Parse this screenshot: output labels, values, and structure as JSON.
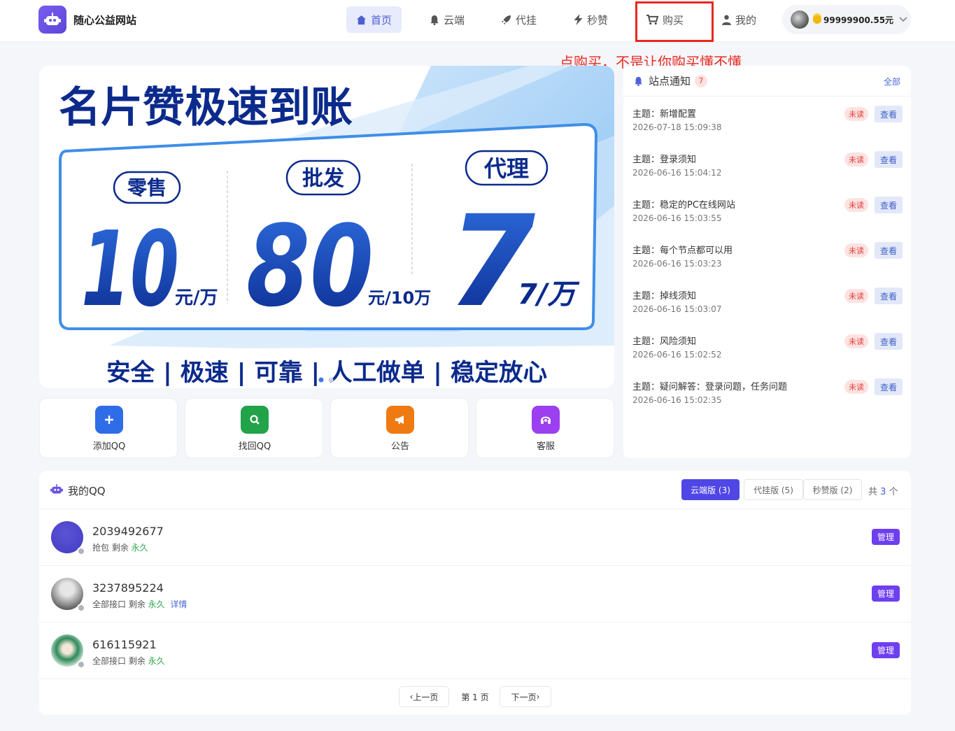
{
  "header": {
    "site_title": "随心公益网站",
    "nav": [
      {
        "label": "首页",
        "icon": "home-icon",
        "active": true
      },
      {
        "label": "云端",
        "icon": "bell-icon"
      },
      {
        "label": "代挂",
        "icon": "rocket-icon"
      },
      {
        "label": "秒赞",
        "icon": "bolt-icon"
      },
      {
        "label": "购买",
        "icon": "cart-icon"
      },
      {
        "label": "我的",
        "icon": "user-icon"
      }
    ],
    "balance": "99999900.55元"
  },
  "annotation": "点购买，不是让你购买懂不懂",
  "banner": {
    "headline": "名片赞极速到账",
    "tiers": [
      {
        "label": "零售",
        "value": "10",
        "unit": "元/万"
      },
      {
        "label": "批发",
        "value": "80",
        "unit": "元/10万"
      },
      {
        "label": "代理",
        "value": "7",
        "unit": "7/万"
      }
    ],
    "tagline": "安全 | 极速 | 可靠 | 人工做单 | 稳定放心"
  },
  "notices": {
    "title": "站点通知",
    "count": "7",
    "all_label": "全部",
    "unread_label": "未读",
    "view_label": "查看",
    "items": [
      {
        "subject": "主题：新增配置",
        "time": "2026-07-18 15:09:38"
      },
      {
        "subject": "主题：登录须知",
        "time": "2026-06-16 15:04:12"
      },
      {
        "subject": "主题：稳定的PC在线网站",
        "time": "2026-06-16 15:03:55"
      },
      {
        "subject": "主题：每个节点都可以用",
        "time": "2026-06-16 15:03:23"
      },
      {
        "subject": "主题：掉线须知",
        "time": "2026-06-16 15:03:07"
      },
      {
        "subject": "主题：风险须知",
        "time": "2026-06-16 15:02:52"
      },
      {
        "subject": "主题：疑问解答：登录问题，任务问题",
        "time": "2026-06-16 15:02:35"
      }
    ]
  },
  "quick_actions": [
    {
      "label": "添加QQ",
      "icon": "plus-icon",
      "color": "#2f6de8"
    },
    {
      "label": "找回QQ",
      "icon": "search-icon",
      "color": "#22a34a"
    },
    {
      "label": "公告",
      "icon": "megaphone-icon",
      "color": "#f07a12"
    },
    {
      "label": "客服",
      "icon": "headset-icon",
      "color": "#9b3ff0"
    }
  ],
  "my_qq": {
    "title": "我的QQ",
    "tabs": [
      {
        "label": "云端版 (3)",
        "active": true
      },
      {
        "label": "代挂版 (5)"
      },
      {
        "label": "秒赞版 (2)"
      }
    ],
    "total_prefix": "共",
    "total_count": "3",
    "total_suffix": "个",
    "manage_label": "管理",
    "rows": [
      {
        "qq": "2039492677",
        "desc": "抢包 剩余",
        "remain": "永久",
        "extra": ""
      },
      {
        "qq": "3237895224",
        "desc": "全部接口 剩余",
        "remain": "永久",
        "extra": "详情"
      },
      {
        "qq": "616115921",
        "desc": "全部接口 剩余",
        "remain": "永久",
        "extra": ""
      }
    ],
    "pagination": {
      "prev": "上一页",
      "page": "第 1 页",
      "next": "下一页"
    }
  }
}
